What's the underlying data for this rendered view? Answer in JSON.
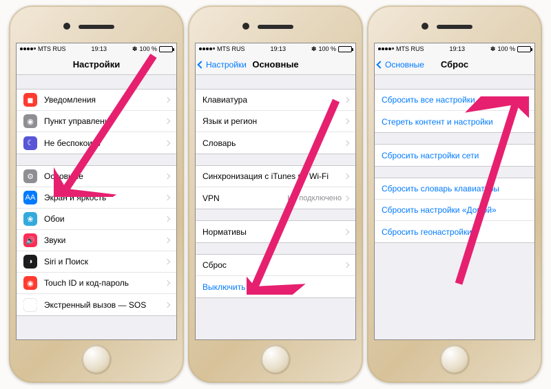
{
  "status": {
    "carrier": "MTS RUS",
    "time": "19:13",
    "battery_pct": "100 %",
    "bt_glyph": "✽"
  },
  "phone1": {
    "title": "Настройки",
    "rows_g1": [
      {
        "label": "Уведомления",
        "icon": "ic-red",
        "iconKey": "notifications-icon",
        "glyph": "◼"
      },
      {
        "label": "Пункт управления",
        "icon": "ic-gray",
        "iconKey": "control-center-icon",
        "glyph": "◉"
      },
      {
        "label": "Не беспокоить",
        "icon": "ic-purple",
        "iconKey": "dnd-icon",
        "glyph": "☾"
      }
    ],
    "rows_g2": [
      {
        "label": "Основные",
        "icon": "ic-gray",
        "iconKey": "general-icon",
        "glyph": "⚙"
      },
      {
        "label": "Экран и яркость",
        "icon": "ic-blue",
        "iconKey": "display-icon",
        "glyph": "AA"
      },
      {
        "label": "Обои",
        "icon": "ic-lblue",
        "iconKey": "wallpaper-icon",
        "glyph": "❀"
      },
      {
        "label": "Звуки",
        "icon": "ic-pink",
        "iconKey": "sounds-icon",
        "glyph": "🔊"
      },
      {
        "label": "Siri и Поиск",
        "icon": "ic-black",
        "iconKey": "siri-icon",
        "glyph": "◑"
      },
      {
        "label": "Touch ID и код-пароль",
        "icon": "ic-red",
        "iconKey": "touchid-icon",
        "glyph": "◉"
      },
      {
        "label": "Экстренный вызов — SOS",
        "icon": "ic-sos",
        "iconKey": "sos-icon",
        "glyph": "SOS"
      }
    ]
  },
  "phone2": {
    "back": "Настройки",
    "title": "Основные",
    "rows_g1": [
      {
        "label": "Клавиатура"
      },
      {
        "label": "Язык и регион"
      },
      {
        "label": "Словарь"
      }
    ],
    "rows_g2": [
      {
        "label": "Синхронизация с iTunes по Wi-Fi"
      },
      {
        "label": "VPN",
        "detail": "Не подключено"
      }
    ],
    "rows_g3": [
      {
        "label": "Нормативы"
      }
    ],
    "rows_g4": [
      {
        "label": "Сброс"
      },
      {
        "label": "Выключить",
        "blue": true,
        "noarrow": true
      }
    ]
  },
  "phone3": {
    "back": "Основные",
    "title": "Сброс",
    "rows_g1": [
      {
        "label": "Сбросить все настройки"
      },
      {
        "label": "Стереть контент и настройки"
      }
    ],
    "rows_g2": [
      {
        "label": "Сбросить настройки сети"
      }
    ],
    "rows_g3": [
      {
        "label": "Сбросить словарь клавиатуры"
      },
      {
        "label": "Сбросить настройки «Домой»"
      },
      {
        "label": "Сбросить геонастройки"
      }
    ]
  },
  "arrowColor": "#e6206f"
}
